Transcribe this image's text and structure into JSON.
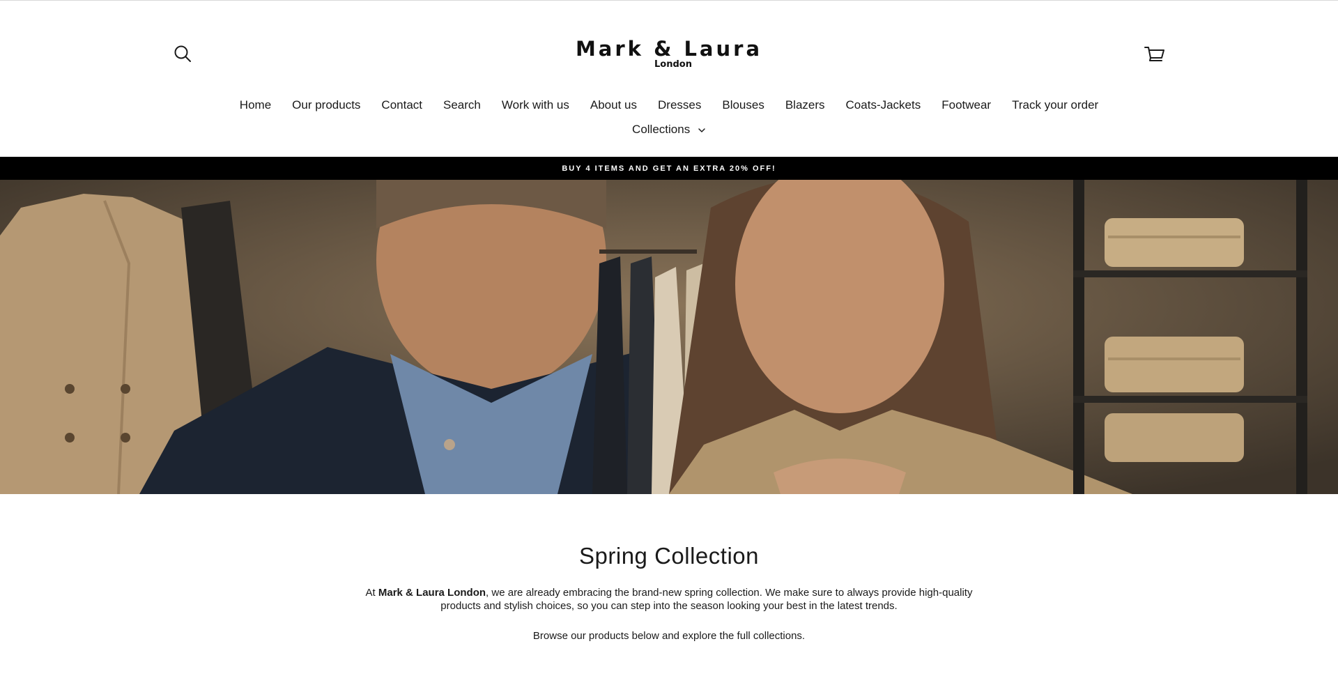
{
  "header": {
    "logo_main": "Mark & Laura",
    "logo_sub": "London",
    "search_icon": "search-icon",
    "cart_icon": "cart-icon"
  },
  "nav": {
    "items": [
      {
        "label": "Home"
      },
      {
        "label": "Our products"
      },
      {
        "label": "Contact"
      },
      {
        "label": "Search"
      },
      {
        "label": "Work with us"
      },
      {
        "label": "About us"
      },
      {
        "label": "Dresses"
      },
      {
        "label": "Blouses"
      },
      {
        "label": "Blazers"
      },
      {
        "label": "Coats-Jackets"
      },
      {
        "label": "Footwear"
      },
      {
        "label": "Track your order"
      }
    ],
    "collections_label": "Collections"
  },
  "promo": {
    "text": "BUY 4 ITEMS AND GET AN EXTRA 20% OFF!"
  },
  "hero": {
    "description_icon": "hero-image"
  },
  "intro": {
    "title": "Spring Collection",
    "p1_prefix": "At ",
    "p1_brand": "Mark & Laura London",
    "p1_rest": ", we are already embracing the brand-new spring collection. We make sure to always provide high-quality products and stylish choices, so you can step into the season looking your best in the latest trends.",
    "p2": "Browse our products below and explore the full collections."
  },
  "colors": {
    "promo_bg": "#000000",
    "promo_text": "#ffffff",
    "text": "#1a1a1a"
  }
}
